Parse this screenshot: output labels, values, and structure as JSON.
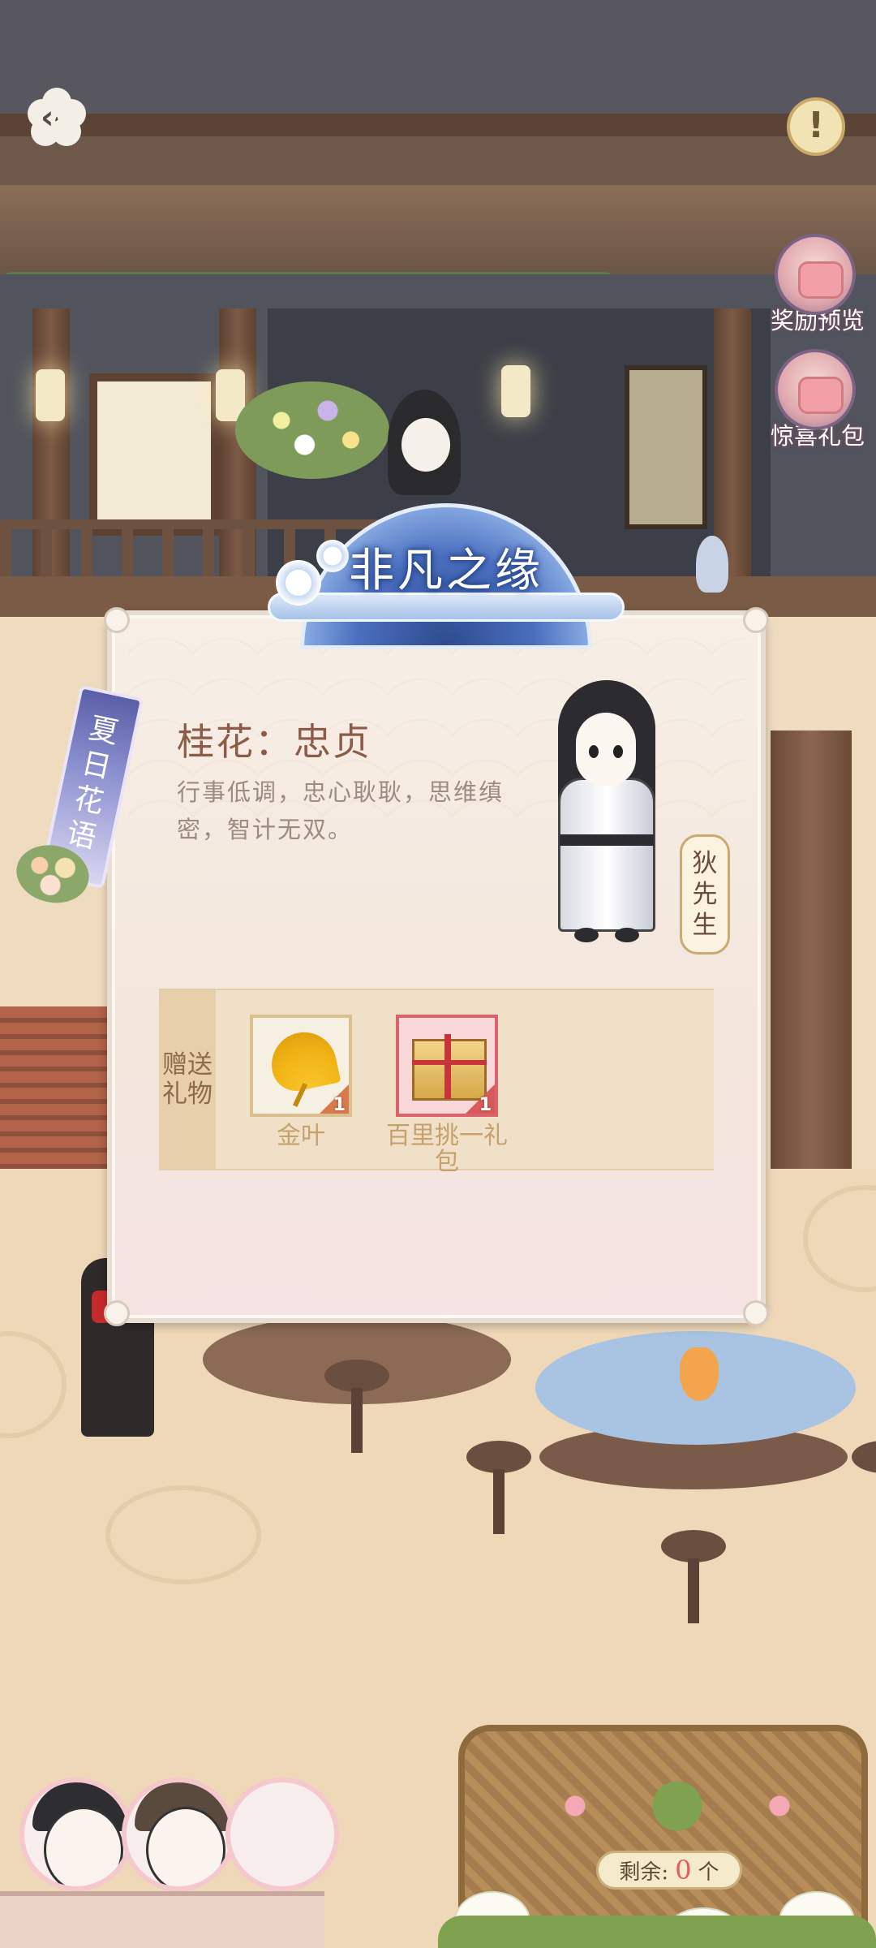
{
  "hud": {
    "back_icon": "back-chevron-icon",
    "info_icon": "exclamation-icon",
    "info_glyph": "!",
    "reward_preview": "奖励预览",
    "surprise_gift": "惊喜礼包"
  },
  "banner": {
    "title": "非凡之缘"
  },
  "side_tag": {
    "text": "夏日花语"
  },
  "card": {
    "flower_title": "桂花：忠贞",
    "description": "行事低调，忠心耿耿，思维缜密，智计无双。",
    "character_name": "狄先生",
    "gift_label": "赠送礼物",
    "gifts": [
      {
        "name": "金叶",
        "count": "1",
        "icon": "ginkgo-leaf-icon"
      },
      {
        "name": "百里挑一礼包",
        "count": "1",
        "icon": "gift-chest-icon"
      }
    ]
  },
  "bottom": {
    "remaining_label": "剩余:",
    "remaining_value": "0",
    "remaining_unit": "个"
  },
  "colors": {
    "accent_red": "#e25c5c",
    "title_brown": "#8c5c48",
    "banner_blue": "#4b6fbf"
  }
}
